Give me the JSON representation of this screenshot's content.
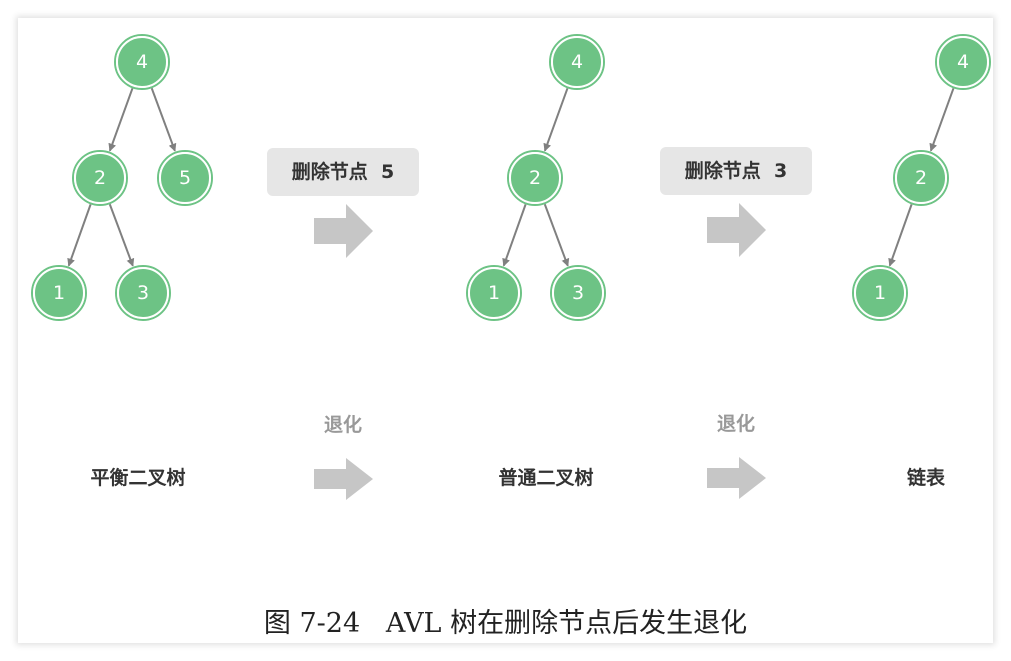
{
  "trees": [
    {
      "nodes": [
        {
          "id": "4",
          "label": "4"
        },
        {
          "id": "2",
          "label": "2"
        },
        {
          "id": "5",
          "label": "5"
        },
        {
          "id": "1",
          "label": "1"
        },
        {
          "id": "3",
          "label": "3"
        }
      ],
      "edges": [
        [
          "4",
          "2"
        ],
        [
          "4",
          "5"
        ],
        [
          "2",
          "1"
        ],
        [
          "2",
          "3"
        ]
      ],
      "label": "平衡二叉树"
    },
    {
      "nodes": [
        {
          "id": "4",
          "label": "4"
        },
        {
          "id": "2",
          "label": "2"
        },
        {
          "id": "1",
          "label": "1"
        },
        {
          "id": "3",
          "label": "3"
        }
      ],
      "edges": [
        [
          "4",
          "2"
        ],
        [
          "2",
          "1"
        ],
        [
          "2",
          "3"
        ]
      ],
      "label": "普通二叉树"
    },
    {
      "nodes": [
        {
          "id": "4",
          "label": "4"
        },
        {
          "id": "2",
          "label": "2"
        },
        {
          "id": "1",
          "label": "1"
        }
      ],
      "edges": [
        [
          "4",
          "2"
        ],
        [
          "2",
          "1"
        ]
      ],
      "label": "链表"
    }
  ],
  "steps": [
    {
      "action": "删除节点  5",
      "degrade": "退化"
    },
    {
      "action": "删除节点  3",
      "degrade": "退化"
    }
  ],
  "caption": "图 7-24   AVL 树在删除节点后发生退化",
  "colors": {
    "node_fill": "#6dc385",
    "node_text": "#ffffff",
    "edge": "#808080",
    "arrow": "#c6c6c6",
    "badge_bg": "#e6e6e6",
    "degrade_text": "#999999",
    "label_text": "#333333"
  }
}
